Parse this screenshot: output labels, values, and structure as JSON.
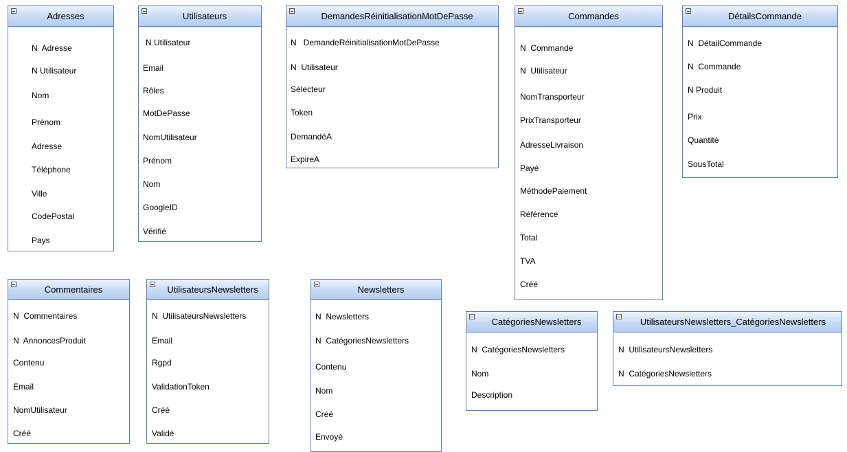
{
  "tables": [
    {
      "title": "Adresses",
      "fields": [
        "N  Adresse",
        "N Utilisateur",
        "Nom",
        "Prénom",
        "Adresse",
        "Téléphone",
        "Ville",
        "CodePostal",
        "Pays"
      ]
    },
    {
      "title": "Utilisateurs",
      "fields": [
        "N Utilisateur",
        "Email",
        "Rôles",
        "MotDePasse",
        "NomUtilisateur",
        "Prénom",
        "Nom",
        "GoogleID",
        "Vérifié"
      ]
    },
    {
      "title": "DemandesRéinitialisationMotDePasse",
      "fields": [
        "N   DemandeRéinitialisationMotDePasse",
        "N  Utilisateur",
        "Sélecteur",
        "Token",
        "DemandéA",
        "ExpireA"
      ]
    },
    {
      "title": "Commandes",
      "fields": [
        "N  Commande",
        "N  Utilisateur",
        "NomTransporteur",
        "PrixTransporteur",
        "AdresseLivraison",
        "Payé",
        "MéthodePaiement",
        "Référence",
        "Total",
        "TVA",
        "Créé"
      ]
    },
    {
      "title": "DétailsCommande",
      "fields": [
        "N  DétailCommande",
        "N  Commande",
        "N Produit",
        "Prix",
        "Quantité",
        "SousTotal"
      ]
    },
    {
      "title": "Commentaires",
      "fields": [
        "N  Commentaires",
        "N  AnnoncesProduit",
        "Contenu",
        "Email",
        "NomUtilisateur",
        "Créé"
      ]
    },
    {
      "title": "UtilisateursNewsletters",
      "fields": [
        "N  UtilisateursNewsletters",
        "Email",
        "Rgpd",
        "ValidationToken",
        "Créé",
        "Validé"
      ]
    },
    {
      "title": "Newsletters",
      "fields": [
        "N  Newsletters",
        "N  CatégoriesNewsletters",
        "Contenu",
        "Nom",
        "Créé",
        "Envoyé"
      ]
    },
    {
      "title": "CatégoriesNewsletters",
      "fields": [
        "N  CatégoriesNewsletters",
        "Nom",
        "Description"
      ]
    },
    {
      "title": "UtilisateursNewsletters_CatégoriesNewsletters",
      "fields": [
        "N  UtilisateursNewsletters",
        "N  CatégoriesNewsletters"
      ]
    }
  ]
}
